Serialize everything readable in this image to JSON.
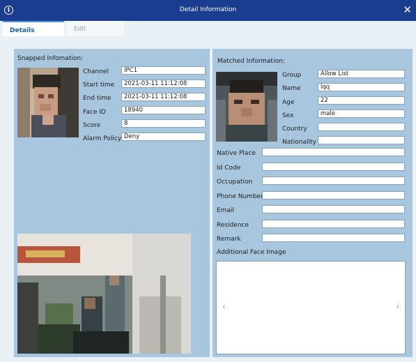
{
  "window": {
    "title": "Detail Information"
  },
  "tabs": [
    {
      "label": "Details"
    },
    {
      "label": "Edit"
    }
  ],
  "snapped": {
    "title": "Snapped Infomation:",
    "fields": [
      {
        "label": "Channel",
        "value": "IPC1"
      },
      {
        "label": "Start time",
        "value": "2021-03-11 11:12:08"
      },
      {
        "label": "End time",
        "value": "2021-03-11 11:12:08"
      },
      {
        "label": "Face ID",
        "value": "18940"
      },
      {
        "label": "Score",
        "value": "8"
      },
      {
        "label": "Alarm Policy",
        "value": "Deny"
      }
    ]
  },
  "matched": {
    "title": "Matched Information:",
    "short_fields": [
      {
        "label": "Group",
        "value": "Allow List"
      },
      {
        "label": "Name",
        "value": "lqq"
      },
      {
        "label": "Age",
        "value": "22"
      },
      {
        "label": "Sex",
        "value": "male"
      },
      {
        "label": "Country",
        "value": ""
      },
      {
        "label": "Nationality",
        "value": ""
      }
    ],
    "long_fields": [
      {
        "label": "Native Place",
        "value": ""
      },
      {
        "label": "Id Code",
        "value": ""
      },
      {
        "label": "Occupation",
        "value": ""
      },
      {
        "label": "Phone Number",
        "value": ""
      },
      {
        "label": "Email",
        "value": ""
      },
      {
        "label": "Residence",
        "value": ""
      },
      {
        "label": "Remark",
        "value": ""
      }
    ],
    "additional_title": "Additional Face Image",
    "prev_glyph": "‹",
    "next_glyph": "›"
  },
  "icons": {
    "info": "info-icon",
    "close": "close-icon"
  }
}
